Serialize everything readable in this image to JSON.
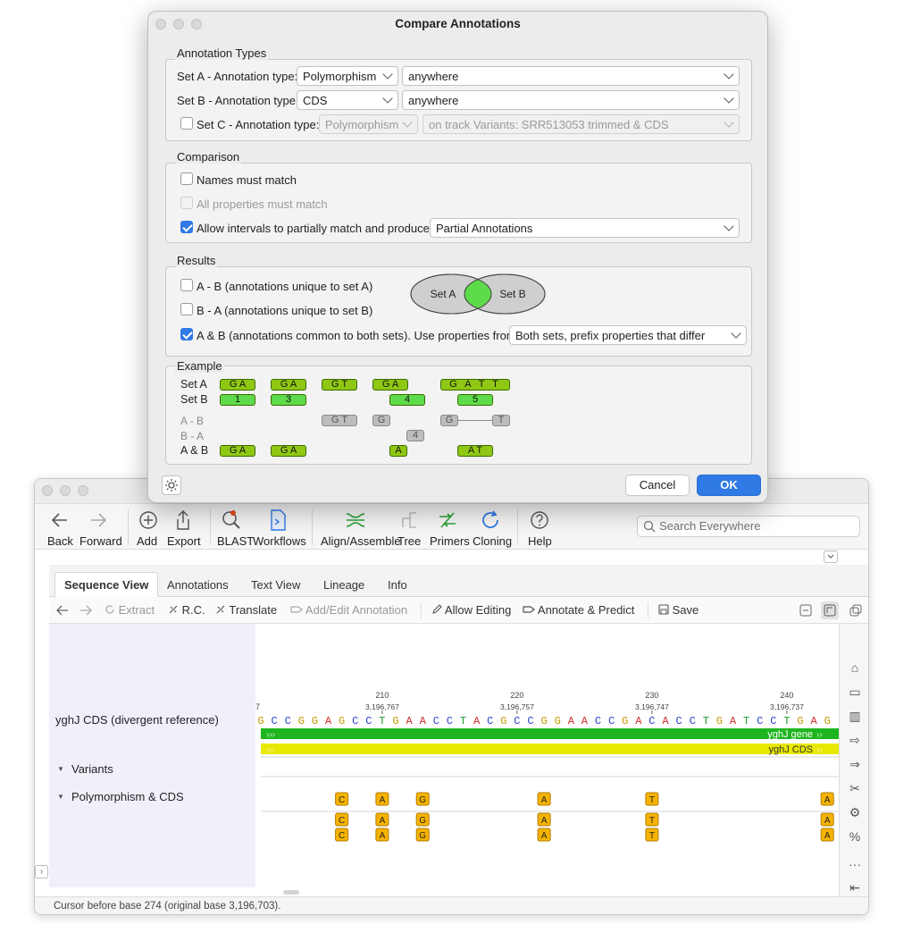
{
  "dialog": {
    "title": "Compare Annotations",
    "annotation_types": {
      "legend": "Annotation Types",
      "set_a_label": "Set A - Annotation type:",
      "set_a_type": "Polymorphism",
      "set_a_where": "anywhere",
      "set_b_label": "Set B - Annotation type:",
      "set_b_type": "CDS",
      "set_b_where": "anywhere",
      "set_c_label": "Set C - Annotation type:",
      "set_c_type": "Polymorphism",
      "set_c_where": "on track Variants: SRR513053 trimmed & CDS"
    },
    "comparison": {
      "legend": "Comparison",
      "names_match": "Names must match",
      "props_match": "All properties must match",
      "partial": "Allow intervals to partially match and produce",
      "partial_value": "Partial Annotations"
    },
    "results": {
      "legend": "Results",
      "a_minus_b": "A - B (annotations unique to set A)",
      "b_minus_a": "B - A (annotations unique to set B)",
      "a_and_b": "A & B (annotations common to both sets). Use properties from",
      "props_value": "Both sets, prefix properties that differ",
      "venn_a": "Set A",
      "venn_b": "Set B"
    },
    "example": {
      "legend": "Example",
      "set_a": "Set A",
      "set_b": "Set B",
      "a_b": "A - B",
      "b_a": "B - A",
      "a_and_b": "A & B",
      "set_a_pills": [
        "G A",
        "G A",
        "G T",
        "G A",
        "G A T T"
      ],
      "set_b_pills": [
        "1",
        "3",
        "4",
        "5"
      ],
      "a_b_pills": [
        "G T",
        "G",
        "G",
        "T"
      ],
      "b_a_pills": [
        "4"
      ],
      "ab_pills": [
        "G A",
        "G A",
        "A",
        "A T"
      ]
    },
    "cancel": "Cancel",
    "ok": "OK"
  },
  "main": {
    "toolbar": {
      "back": "Back",
      "forward": "Forward",
      "add": "Add",
      "export": "Export",
      "blast": "BLAST",
      "workflows": "Workflows",
      "align": "Align/Assemble",
      "tree": "Tree",
      "primers": "Primers",
      "cloning": "Cloning",
      "help": "Help",
      "search_placeholder": "Search Everywhere"
    },
    "tabs": [
      "Sequence View",
      "Annotations",
      "Text View",
      "Lineage",
      "Info"
    ],
    "seqbar": {
      "extract": "Extract",
      "rc": "R.C.",
      "translate": "Translate",
      "add_edit": "Add/Edit Annotation",
      "allow_editing": "Allow Editing",
      "annotate": "Annotate & Predict",
      "save": "Save"
    },
    "ruler": {
      "ticks": [
        "210",
        "220",
        "230",
        "240"
      ],
      "orig": [
        "3,196,767",
        "3,196,757",
        "3,196,747",
        "3,196,737"
      ],
      "left_num": "7"
    },
    "sequence": "GCCGGAGCCTGAACCTACGCCGGAACCGACACCTGATCCTGAG",
    "tracks": {
      "seq_label": "yghJ CDS (divergent reference)",
      "gene_label": "yghJ gene",
      "cds_label": "yghJ CDS",
      "variants": "Variants",
      "polymorphism": "Polymorphism & CDS",
      "variant_bases": [
        "C",
        "A",
        "G",
        "A",
        "T",
        "A"
      ]
    },
    "status": "Cursor before base 274 (original base 3,196,703)."
  },
  "colors": {
    "accent": "#2f7ae5",
    "olive_pill": "#8fc814",
    "green_pill": "#5edb4a",
    "gene_track": "#1fb51f",
    "cds_track": "#e8e800",
    "variant": "#f5b300"
  }
}
